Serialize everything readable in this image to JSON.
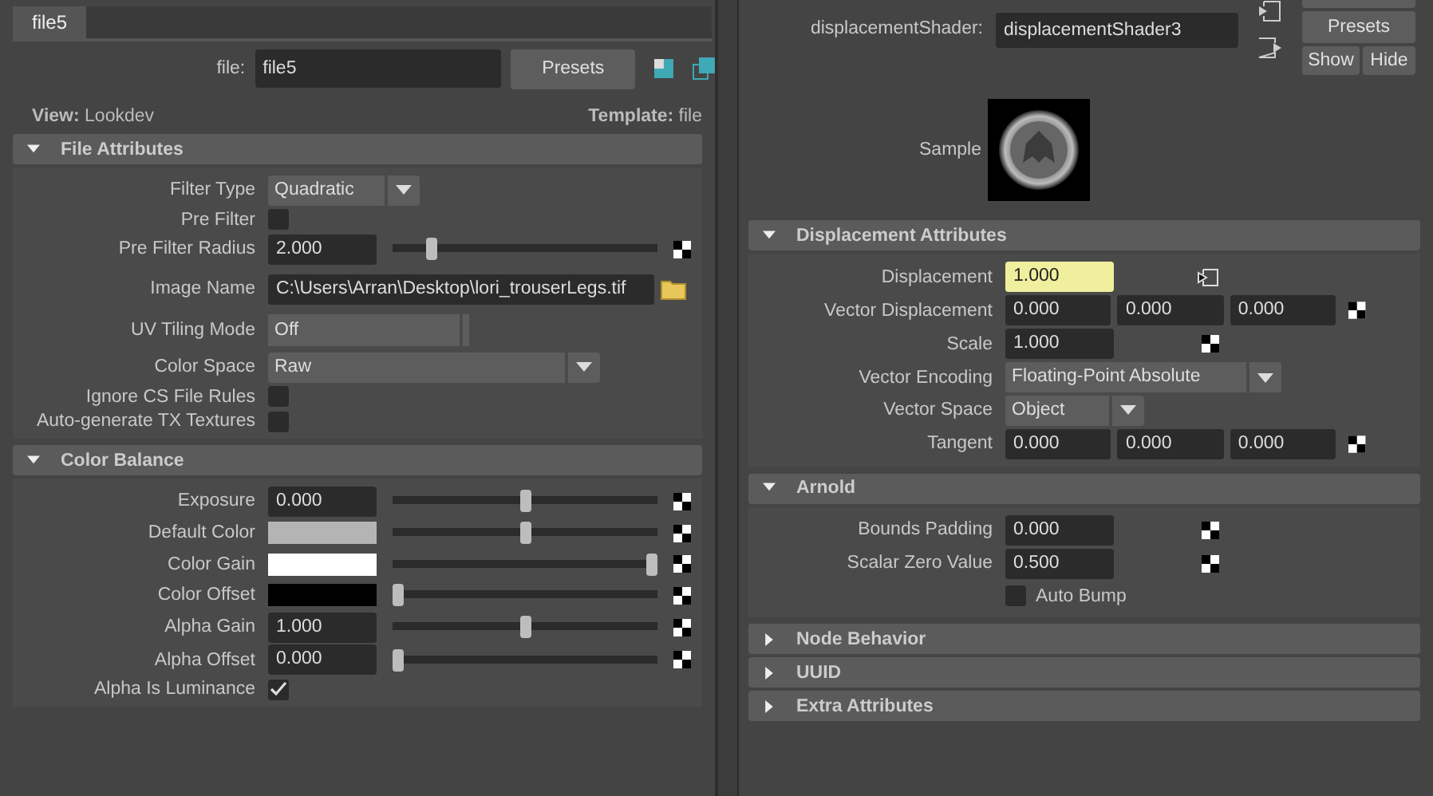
{
  "left": {
    "tab": {
      "label": "file5",
      "selected": true
    },
    "node_field": {
      "label": "file:",
      "value": "file5"
    },
    "presets_button": "Presets",
    "view": {
      "label": "View:",
      "value": "Lookdev"
    },
    "template": {
      "label": "Template:",
      "value": "file"
    },
    "sections": [
      {
        "title": "File Attributes",
        "expanded": true,
        "rows": [
          {
            "kind": "dropdown",
            "label": "Filter Type",
            "value": "Quadratic"
          },
          {
            "kind": "checkbox",
            "label": "Pre Filter",
            "checked": false
          },
          {
            "kind": "slider",
            "label": "Pre Filter Radius",
            "value": "2.000",
            "level": 0.13,
            "map": true
          },
          {
            "kind": "path",
            "label": "Image Name",
            "value": "C:\\Users\\Arran\\Desktop\\lori_trouserLegs.tif"
          },
          {
            "kind": "option",
            "label": "UV Tiling Mode",
            "value": "Off"
          },
          {
            "kind": "wide_dropdown",
            "label": "Color Space",
            "value": "Raw"
          },
          {
            "kind": "checkbox",
            "label": "Ignore CS File Rules",
            "checked": false
          },
          {
            "kind": "checkbox",
            "label": "Auto-generate TX Textures",
            "checked": false
          }
        ]
      },
      {
        "title": "Color Balance",
        "expanded": true,
        "rows": [
          {
            "kind": "slider",
            "label": "Exposure",
            "value": "0.000",
            "level": 0.5,
            "map": true
          },
          {
            "kind": "color_slider",
            "label": "Default Color",
            "color": "#b4b4b4",
            "level": 0.5,
            "map": true
          },
          {
            "kind": "color_slider",
            "label": "Color Gain",
            "color": "#ffffff",
            "level": 1,
            "map": true
          },
          {
            "kind": "color_slider",
            "label": "Color Offset",
            "color": "#000000",
            "level": 0,
            "map": true
          },
          {
            "kind": "slider",
            "label": "Alpha Gain",
            "value": "1.000",
            "level": 0.5,
            "map": true
          },
          {
            "kind": "slider",
            "label": "Alpha Offset",
            "value": "0.000",
            "level": 0,
            "map": true
          },
          {
            "kind": "checkbox",
            "label": "Alpha Is Luminance",
            "checked": true
          }
        ]
      }
    ]
  },
  "right": {
    "node_field": {
      "label": "displacementShader:",
      "value": "displacementShader3"
    },
    "buttons": [
      "Presets",
      "Show",
      "Hide"
    ],
    "sample_label": "Sample",
    "sections": [
      {
        "title": "Displacement Attributes",
        "expanded": true,
        "rows": [
          {
            "kind": "number",
            "label": "Displacement",
            "value": "1.000",
            "highlighted": true,
            "connected": true
          },
          {
            "kind": "vector",
            "label": "Vector Displacement",
            "values": [
              "0.000",
              "0.000",
              "0.000"
            ],
            "map": true
          },
          {
            "kind": "number",
            "label": "Scale",
            "value": "1.000",
            "highlighted": false,
            "map": true
          },
          {
            "kind": "dropdown",
            "label": "Vector Encoding",
            "value": "Floating-Point Absolute"
          },
          {
            "kind": "short_dropdown",
            "label": "Vector Space",
            "value": "Object"
          },
          {
            "kind": "vector",
            "label": "Tangent",
            "values": [
              "0.000",
              "0.000",
              "0.000"
            ],
            "map": true
          }
        ]
      },
      {
        "title": "Arnold",
        "expanded": true,
        "rows": [
          {
            "kind": "number",
            "label": "Bounds Padding",
            "value": "0.000",
            "highlighted": false,
            "map": true
          },
          {
            "kind": "number",
            "label": "Scalar Zero Value",
            "value": "0.500",
            "highlighted": false,
            "map": true
          },
          {
            "kind": "inline_checkbox",
            "label": "Auto Bump",
            "checked": false
          }
        ]
      },
      {
        "title": "Node Behavior",
        "expanded": false
      },
      {
        "title": "UUID",
        "expanded": false
      },
      {
        "title": "Extra Attributes",
        "expanded": false
      }
    ]
  }
}
